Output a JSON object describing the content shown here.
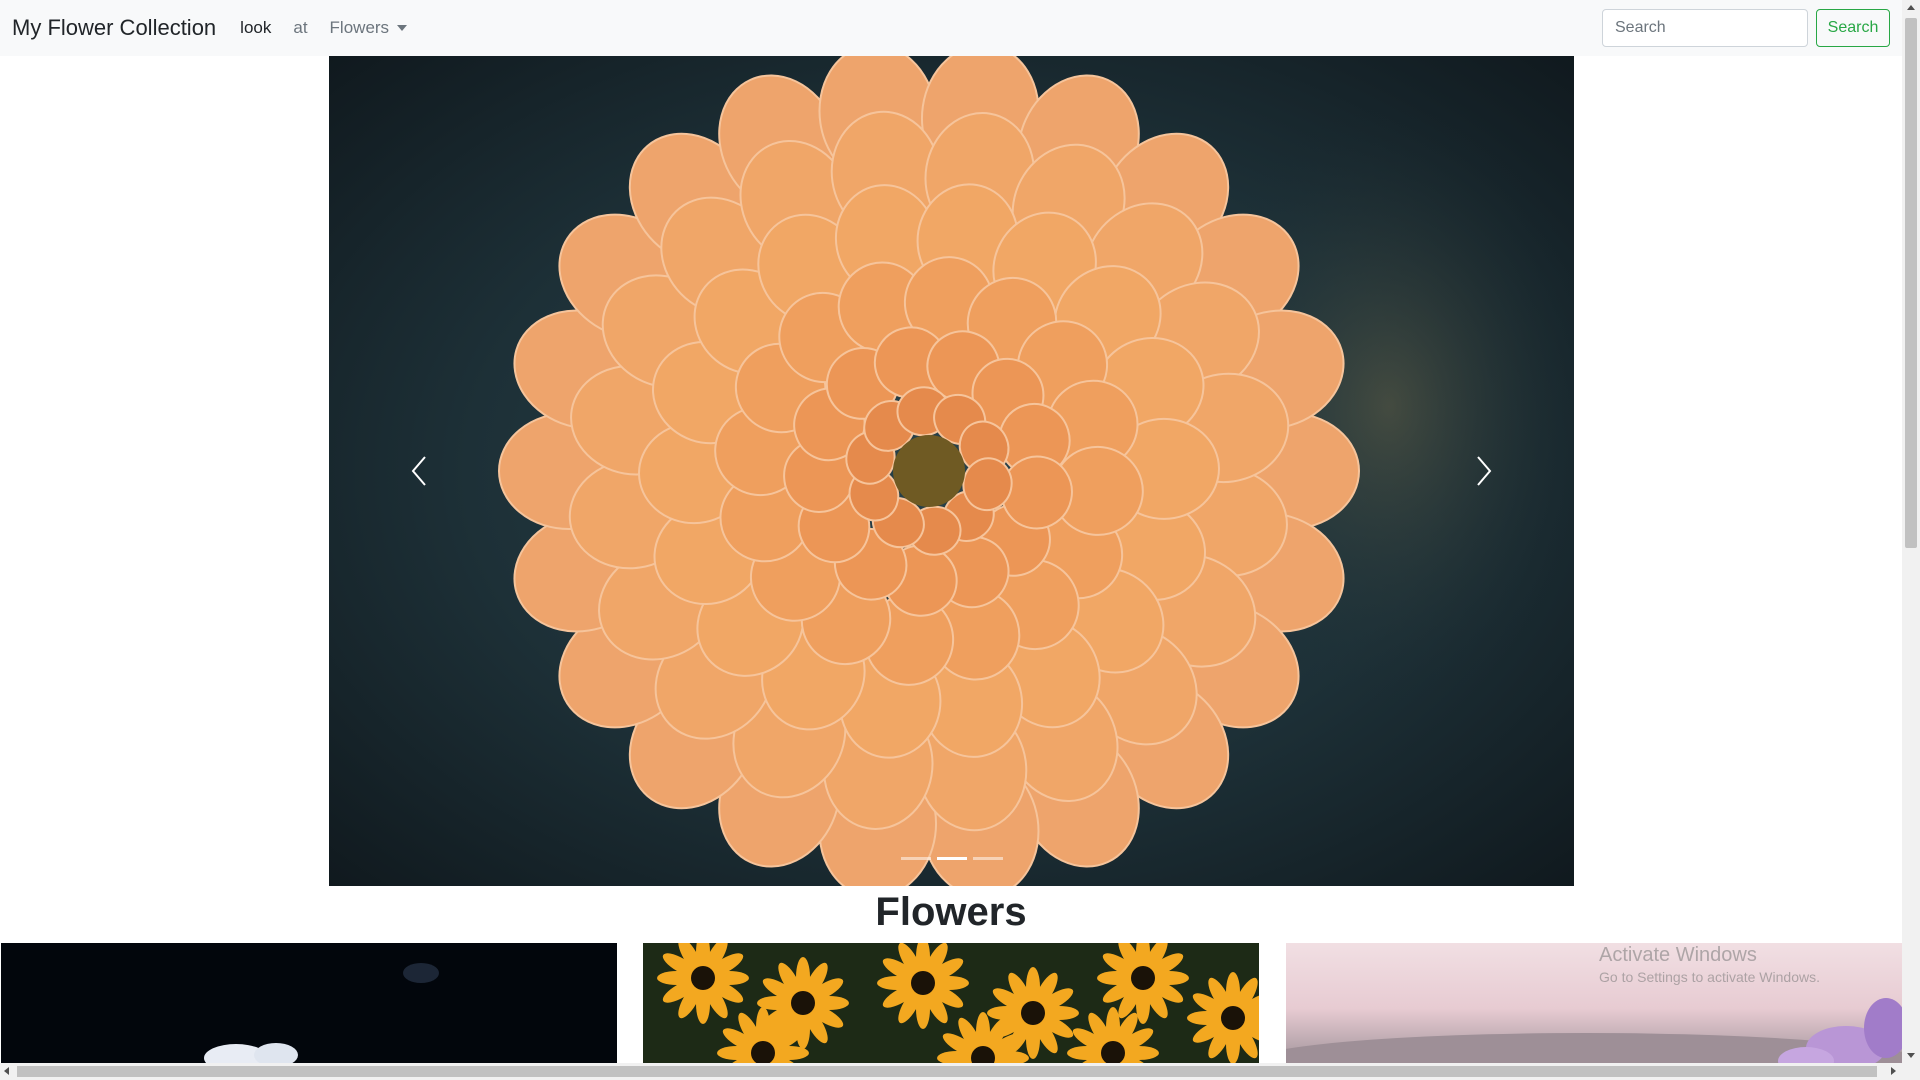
{
  "navbar": {
    "brand": "My Flower Collection",
    "links": [
      {
        "label": "look"
      },
      {
        "label": "at"
      },
      {
        "label": "Flowers"
      }
    ],
    "search_placeholder": "Search",
    "search_button": "Search"
  },
  "carousel": {
    "slide_subject": "orange dahlia",
    "active_slide": 2,
    "slide_count": 3,
    "prev_icon": "chevron-left-icon",
    "next_icon": "chevron-right-icon"
  },
  "section": {
    "title": "Flowers"
  },
  "cards": [
    {
      "subject": "white flower on dark background"
    },
    {
      "subject": "yellow black-eyed susans"
    },
    {
      "subject": "purple flowers on pink sky"
    }
  ],
  "watermark": {
    "line1": "Activate Windows",
    "line2": "Go to Settings to activate Windows."
  },
  "colors": {
    "navbar_bg": "#f8f9fa",
    "search_button": "#28a745",
    "dahlia": "#f0a063"
  }
}
